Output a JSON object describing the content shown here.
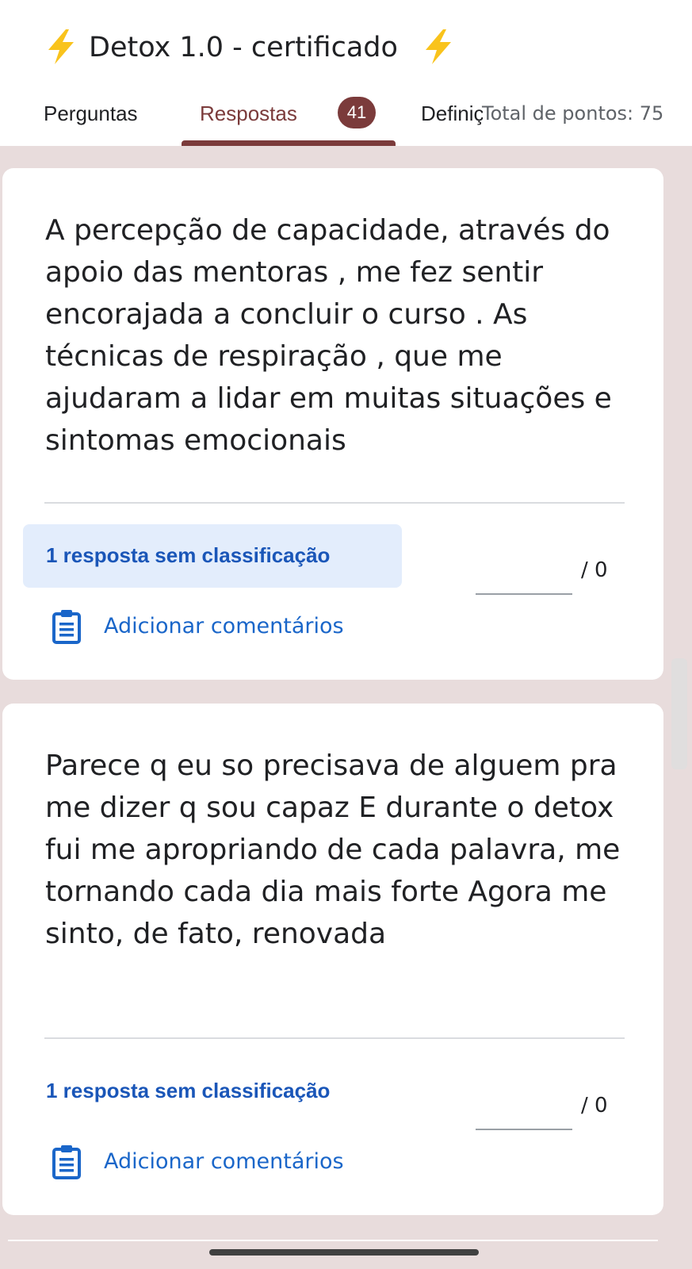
{
  "header": {
    "title": "Detox 1.0 - certificado",
    "title_icon": "lightning-bolt-icon",
    "bolt_color": "#f9c31c"
  },
  "tabs": {
    "perguntas": "Perguntas",
    "respostas": "Respostas",
    "respostas_count": "41",
    "definicoes": "Definições",
    "total_pontos": "Total de pontos: 75"
  },
  "colors": {
    "accent": "#7b3b3b",
    "background": "#e8dcdc",
    "link": "#1a66c9",
    "unscored_highlight": "#e3edfc"
  },
  "responses": [
    {
      "text": "A percepção de capacidade, através do apoio das mentoras , me fez sentir encorajada a concluir o curso . As técnicas de respiração , que me ajudaram a lidar em muitas situações e sintomas emocionais",
      "unscored_label": "1 resposta sem classificação",
      "score_max": "/ 0",
      "comment_label": "Adicionar comentários",
      "comment_icon": "comment-clipboard-icon"
    },
    {
      "text": "Parece q eu so precisava de alguem pra me dizer q sou capaz E durante o detox fui me apropriando de cada palavra, me tornando cada dia mais forte Agora me sinto, de fato, renovada",
      "unscored_label": "1 resposta sem classificação",
      "score_max": "/ 0",
      "comment_label": "Adicionar comentários",
      "comment_icon": "comment-clipboard-icon"
    }
  ]
}
